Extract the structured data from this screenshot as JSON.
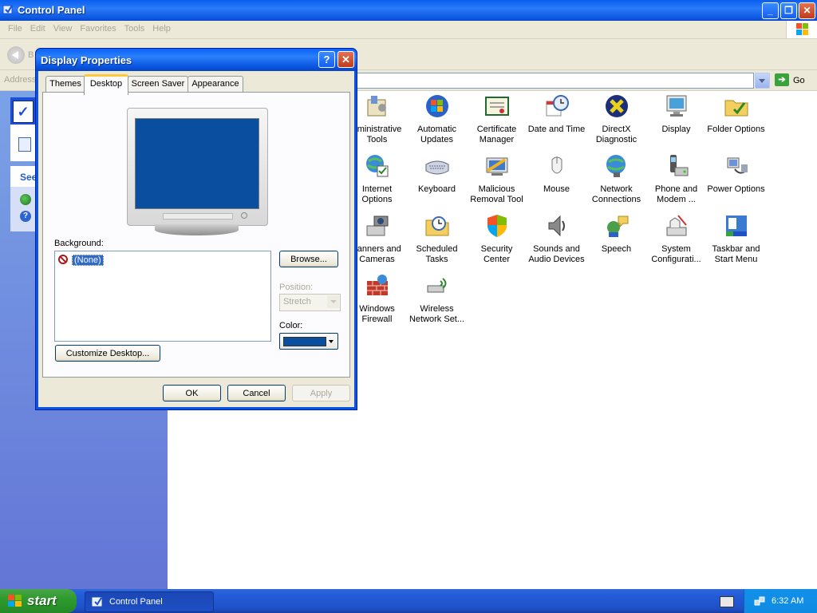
{
  "window": {
    "title": "Control Panel",
    "menu": [
      "File",
      "Edit",
      "View",
      "Favorites",
      "Tools",
      "Help"
    ],
    "back_label": "B",
    "address_label": "Address",
    "go_label": "Go"
  },
  "taskpane": {
    "see_also_label": "See"
  },
  "icons": [
    {
      "name": "administrative-tools",
      "label1": "dministrative",
      "label2": "Tools"
    },
    {
      "name": "automatic-updates",
      "label1": "Automatic",
      "label2": "Updates"
    },
    {
      "name": "certificate-manager",
      "label1": "Certificate",
      "label2": "Manager"
    },
    {
      "name": "date-and-time",
      "label1": "Date and Time",
      "label2": ""
    },
    {
      "name": "directx-diagnostic",
      "label1": "DirectX",
      "label2": "Diagnostic"
    },
    {
      "name": "display",
      "label1": "Display",
      "label2": ""
    },
    {
      "name": "folder-options",
      "label1": "Folder Options",
      "label2": ""
    },
    {
      "name": "internet-options",
      "label1": "Internet",
      "label2": "Options"
    },
    {
      "name": "keyboard",
      "label1": "Keyboard",
      "label2": ""
    },
    {
      "name": "malicious-removal-tool",
      "label1": "Malicious",
      "label2": "Removal Tool"
    },
    {
      "name": "mouse",
      "label1": "Mouse",
      "label2": ""
    },
    {
      "name": "network-connections",
      "label1": "Network",
      "label2": "Connections"
    },
    {
      "name": "phone-and-modem",
      "label1": "Phone and",
      "label2": "Modem ..."
    },
    {
      "name": "power-options",
      "label1": "Power Options",
      "label2": ""
    },
    {
      "name": "scanners-and-cameras",
      "label1": "canners and",
      "label2": "Cameras"
    },
    {
      "name": "scheduled-tasks",
      "label1": "Scheduled",
      "label2": "Tasks"
    },
    {
      "name": "security-center",
      "label1": "Security",
      "label2": "Center"
    },
    {
      "name": "sounds-and-audio",
      "label1": "Sounds and",
      "label2": "Audio Devices"
    },
    {
      "name": "speech",
      "label1": "Speech",
      "label2": ""
    },
    {
      "name": "system-configuration",
      "label1": "System",
      "label2": "Configurati..."
    },
    {
      "name": "taskbar-and-start-menu",
      "label1": "Taskbar and",
      "label2": "Start Menu"
    },
    {
      "name": "windows-firewall",
      "label1": "Windows",
      "label2": "Firewall"
    },
    {
      "name": "wireless-network-setup",
      "label1": "Wireless",
      "label2": "Network Set..."
    }
  ],
  "dialog": {
    "title": "Display Properties",
    "help_glyph": "?",
    "close_glyph": "✕",
    "tabs": [
      "Themes",
      "Desktop",
      "Screen Saver",
      "Appearance"
    ],
    "active_tab": "Desktop",
    "background_label": "Background:",
    "background_items": [
      "(None)"
    ],
    "browse_label": "Browse...",
    "position_label": "Position:",
    "position_value": "Stretch",
    "color_label": "Color:",
    "selected_color": "#0a4ea0",
    "customize_label": "Customize Desktop...",
    "ok_label": "OK",
    "cancel_label": "Cancel",
    "apply_label": "Apply"
  },
  "taskbar": {
    "start_label": "start",
    "task_label": "Control Panel",
    "clock": "6:32 AM"
  }
}
